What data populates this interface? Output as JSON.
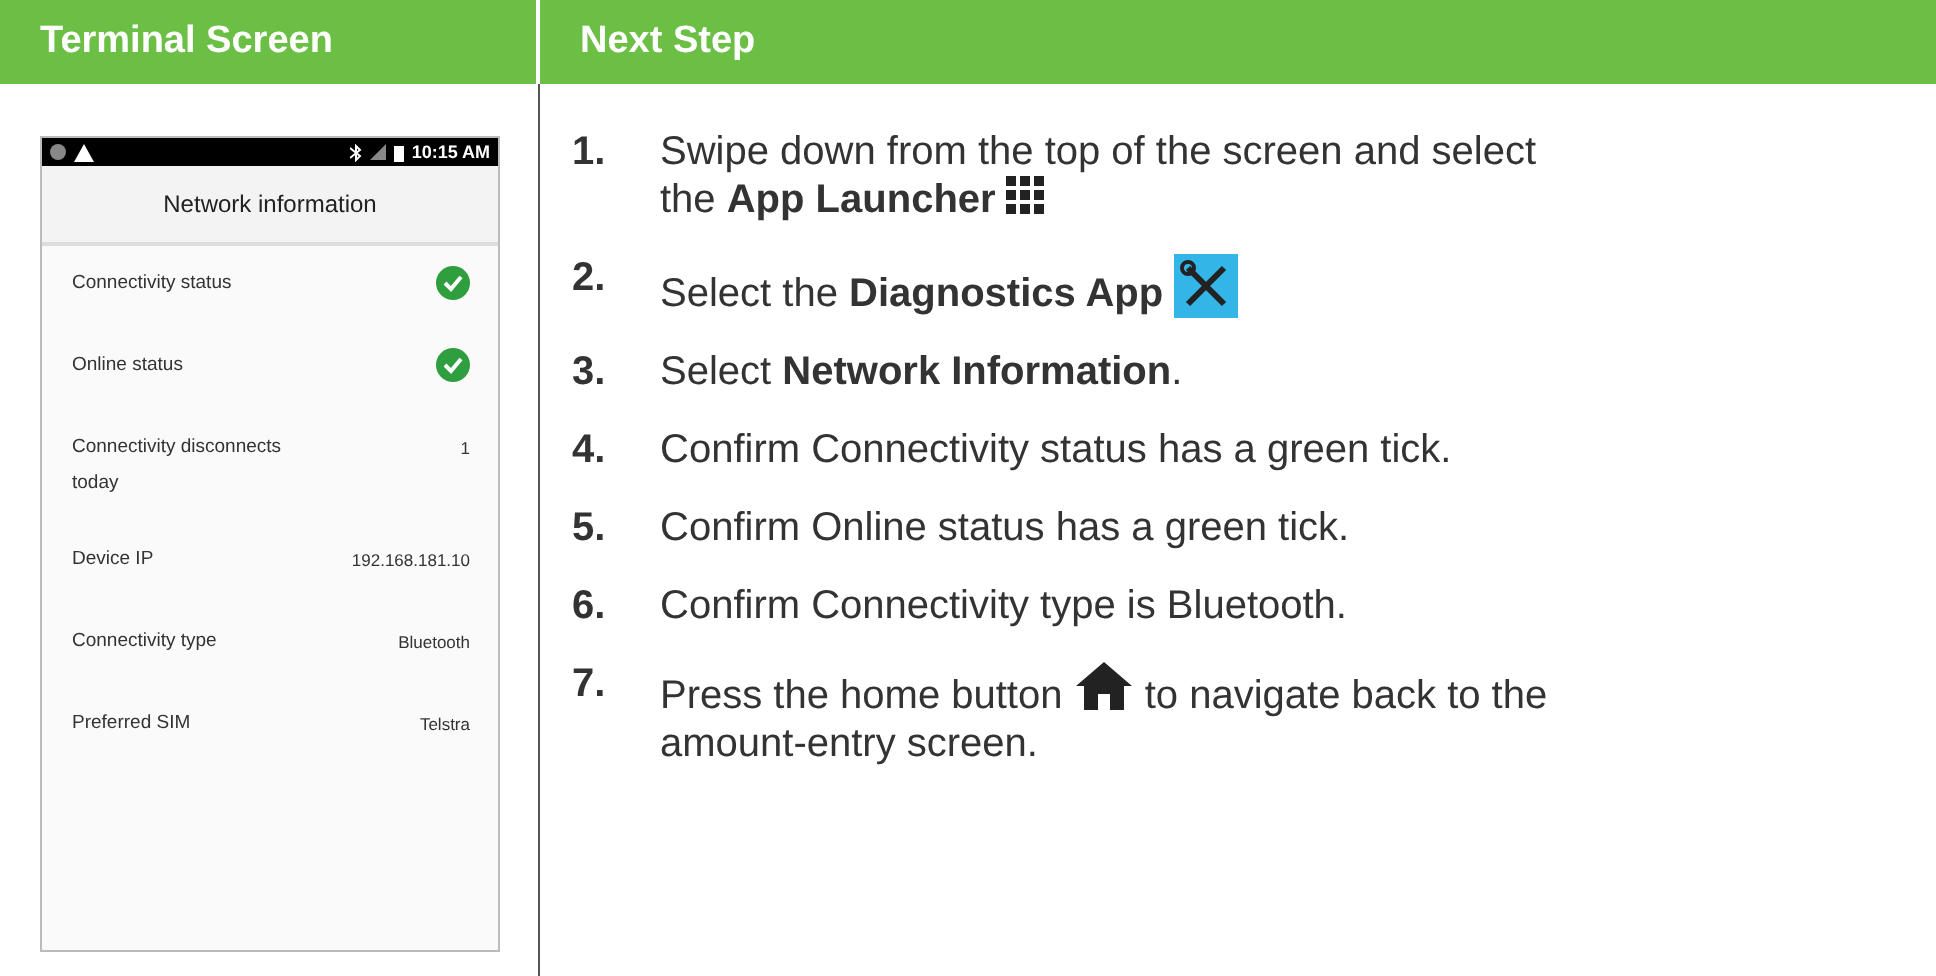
{
  "columns": [
    "Terminal Screen",
    "Next Step"
  ],
  "terminal": {
    "status_time": "10:15 AM",
    "title": "Network information",
    "rows": [
      {
        "label": "Connectivity status",
        "kind": "check",
        "checked": true
      },
      {
        "label": "Online status",
        "kind": "check",
        "checked": true
      },
      {
        "label": "Connectivity disconnects today",
        "kind": "text",
        "value": "1"
      },
      {
        "label": "Device IP",
        "kind": "text",
        "value": "192.168.181.10"
      },
      {
        "label": "Connectivity type",
        "kind": "text",
        "value": "Bluetooth"
      },
      {
        "label": "Preferred SIM",
        "kind": "text",
        "value": "Telstra"
      }
    ]
  },
  "steps": [
    {
      "number": "1.",
      "text": "Swipe down from the top of the screen and select the **App Launcher**",
      "kind": "grid"
    },
    {
      "number": "2.",
      "text": "Select the **Diagnostics App**",
      "kind": "tools"
    },
    {
      "number": "3.",
      "text": "Select **Network Information**."
    },
    {
      "number": "4.",
      "text": "Confirm Connectivity status has a green tick."
    },
    {
      "number": "5.",
      "text": "Confirm Online status has a green tick."
    },
    {
      "number": "6.",
      "text": "Confirm Connectivity type is Bluetooth."
    },
    {
      "number": "7.",
      "text": "Press the home button",
      "kind": "home",
      "after": "to navigate back to the amount-entry screen."
    }
  ]
}
